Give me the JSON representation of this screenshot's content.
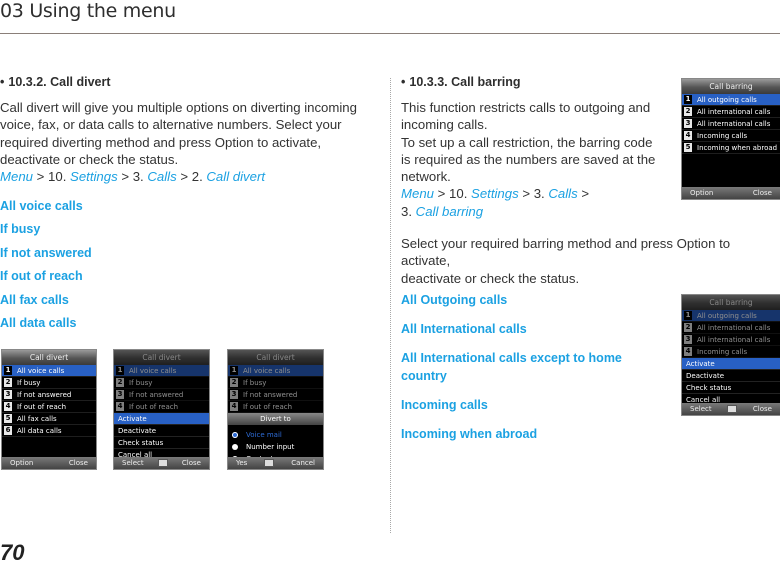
{
  "header": {
    "title": "03 Using the menu"
  },
  "page_number": "70",
  "colors": {
    "link": "#1ba1e2",
    "text": "#333333",
    "selection": "#2860c4"
  },
  "divert": {
    "heading": "10.3.2. Call divert",
    "bullet": "•",
    "body": [
      "Call divert will give you multiple options on diverting incoming",
      "voice, fax, or data calls to alternative numbers. Select your",
      "required diverting method and press Option to activate,",
      "deactivate or check the status."
    ],
    "path": {
      "menu": "Menu",
      "sep1": " > 10. ",
      "settings": "Settings",
      "sep2": " > 3. ",
      "calls": "Calls",
      "sep3": " > 2. ",
      "target": "Call divert"
    },
    "options": [
      "All voice calls",
      "If busy",
      "If not answered",
      "If out of reach",
      "All fax calls",
      "All data calls"
    ],
    "screens": {
      "list": {
        "title": "Call divert",
        "items": [
          {
            "num": "1",
            "label": "All voice calls"
          },
          {
            "num": "2",
            "label": "If busy"
          },
          {
            "num": "3",
            "label": "If not answered"
          },
          {
            "num": "4",
            "label": "If out of reach"
          },
          {
            "num": "5",
            "label": "All fax calls"
          },
          {
            "num": "6",
            "label": "All data calls"
          }
        ],
        "left_soft": "Option",
        "right_soft": "Close"
      },
      "options_menu": {
        "title": "Call divert",
        "items": [
          {
            "num": "1",
            "label": "All voice calls"
          },
          {
            "num": "2",
            "label": "If busy"
          },
          {
            "num": "3",
            "label": "If not answered"
          },
          {
            "num": "4",
            "label": "If out of reach"
          }
        ],
        "menu": [
          "Activate",
          "Deactivate",
          "Check status",
          "Cancel all"
        ],
        "left_soft": "Select",
        "right_soft": "Close"
      },
      "divert_to": {
        "title": "Call divert",
        "items": [
          {
            "num": "1",
            "label": "All voice calls"
          },
          {
            "num": "2",
            "label": "If busy"
          },
          {
            "num": "3",
            "label": "If not answered"
          },
          {
            "num": "4",
            "label": "If out of reach"
          }
        ],
        "popup_title": "Divert to",
        "radios": [
          "Voice mail",
          "Number input",
          "Contact"
        ],
        "left_soft": "Yes",
        "right_soft": "Cancel"
      }
    }
  },
  "barring": {
    "heading": "10.3.3. Call barring",
    "bullet": "•",
    "body": [
      "This function restricts calls to outgoing and",
      "incoming calls.",
      "To set up a call restriction, the barring code",
      "is required as the numbers are saved at the",
      "network."
    ],
    "path": {
      "menu": "Menu",
      "sep1": " > 10. ",
      "settings": "Settings",
      "sep2": " > 3. ",
      "calls": "Calls",
      "sep3": " >",
      "sep4": "3. ",
      "target": "Call barring"
    },
    "body2": [
      "Select your required barring method and press Option to activate,",
      "deactivate or check the status."
    ],
    "options": [
      "All Outgoing calls",
      "All International calls",
      "All International calls except to home",
      "country",
      "Incoming calls",
      "Incoming when abroad"
    ],
    "screens": {
      "list": {
        "title": "Call barring",
        "items": [
          {
            "num": "1",
            "label": "All outgoing calls"
          },
          {
            "num": "2",
            "label": "All international calls"
          },
          {
            "num": "3",
            "label": "All international calls"
          },
          {
            "num": "4",
            "label": "Incoming calls"
          },
          {
            "num": "5",
            "label": "Incoming when abroad"
          }
        ],
        "left_soft": "Option",
        "right_soft": "Close"
      },
      "options_menu": {
        "title": "Call barring",
        "items": [
          {
            "num": "1",
            "label": "All outgoing calls"
          },
          {
            "num": "2",
            "label": "All international calls"
          },
          {
            "num": "3",
            "label": "All international calls"
          },
          {
            "num": "4",
            "label": "Incoming calls"
          }
        ],
        "menu": [
          "Activate",
          "Deactivate",
          "Check status",
          "Cancel all"
        ],
        "left_soft": "Select",
        "right_soft": "Close"
      }
    }
  }
}
